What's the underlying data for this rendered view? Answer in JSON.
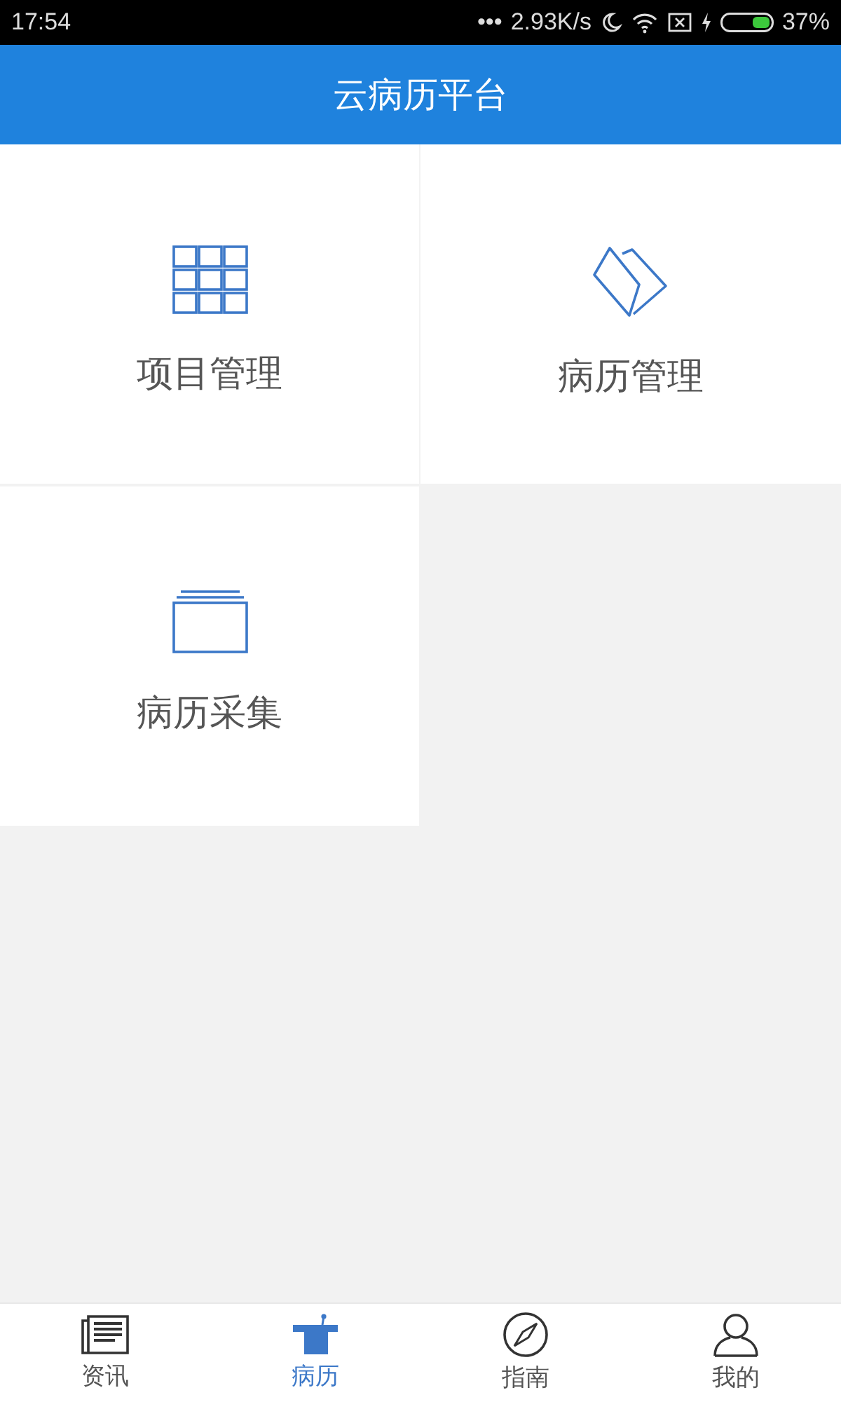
{
  "status_bar": {
    "time": "17:54",
    "more": "•••",
    "speed": "2.93K/s",
    "battery": "37%"
  },
  "header": {
    "title": "云病历平台"
  },
  "tiles": [
    {
      "kind": "grid",
      "label": "项目管理"
    },
    {
      "kind": "folder",
      "label": "病历管理"
    },
    {
      "kind": "stack",
      "label": "病历采集"
    }
  ],
  "tabs": [
    {
      "kind": "news",
      "label": "资讯",
      "selected": false
    },
    {
      "kind": "podium",
      "label": "病历",
      "selected": true
    },
    {
      "kind": "compass",
      "label": "指南",
      "selected": false
    },
    {
      "kind": "person",
      "label": "我的",
      "selected": false
    }
  ]
}
